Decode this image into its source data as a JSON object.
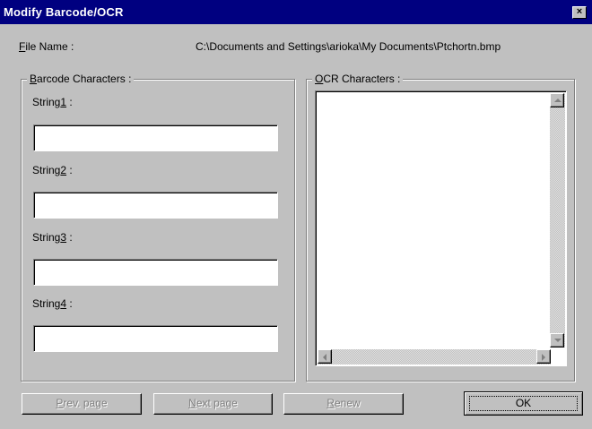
{
  "window": {
    "title": "Modify Barcode/OCR",
    "close_label": "×"
  },
  "file": {
    "label_accel": "F",
    "label_rest": "ile Name :",
    "path": "C:\\Documents and Settings\\arioka\\My Documents\\Ptchortn.bmp"
  },
  "barcode": {
    "title_accel": "B",
    "title_rest": "arcode Characters :",
    "strings": [
      {
        "label_pre": "String",
        "label_accel": "1",
        "label_post": " :",
        "value": ""
      },
      {
        "label_pre": "String",
        "label_accel": "2",
        "label_post": " :",
        "value": ""
      },
      {
        "label_pre": "String",
        "label_accel": "3",
        "label_post": " :",
        "value": ""
      },
      {
        "label_pre": "String",
        "label_accel": "4",
        "label_post": " :",
        "value": ""
      }
    ]
  },
  "ocr": {
    "title_accel": "O",
    "title_rest": "CR Characters :",
    "value": ""
  },
  "buttons": {
    "prev": {
      "accel": "P",
      "rest": "rev. page",
      "enabled": false
    },
    "next": {
      "accel": "N",
      "rest": "ext page",
      "enabled": false
    },
    "renew": {
      "accel": "R",
      "rest": "enew",
      "enabled": false
    },
    "ok": {
      "label": "OK",
      "enabled": true
    }
  },
  "colors": {
    "titlebar": "#000080",
    "face": "#c0c0c0",
    "disabled_text": "#808080"
  }
}
